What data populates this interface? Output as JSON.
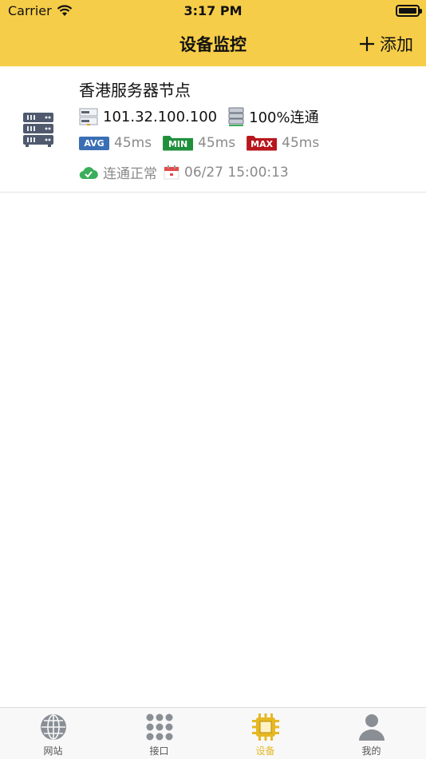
{
  "status_bar": {
    "carrier": "Carrier",
    "time": "3:17 PM"
  },
  "nav": {
    "title": "设备监控",
    "add_label": "添加"
  },
  "devices": [
    {
      "name": "香港服务器节点",
      "ip": "101.32.100.100",
      "connectivity": "100%连通",
      "avg_tag": "AVG",
      "avg": "45ms",
      "min_tag": "MIN",
      "min": "45ms",
      "max_tag": "MAX",
      "max": "45ms",
      "status": "连通正常",
      "time": "06/27 15:00:13"
    }
  ],
  "tabs": [
    {
      "label": "网站",
      "icon": "globe-icon",
      "active": false
    },
    {
      "label": "接口",
      "icon": "grid-dots-icon",
      "active": false
    },
    {
      "label": "设备",
      "icon": "chip-icon",
      "active": true
    },
    {
      "label": "我的",
      "icon": "person-icon",
      "active": false
    }
  ],
  "colors": {
    "header": "#f6cd48",
    "active_tab": "#e6b822",
    "avg": "#3a6fb5",
    "min": "#1f8f3b",
    "max": "#b8161d",
    "ok": "#3aae5a"
  }
}
